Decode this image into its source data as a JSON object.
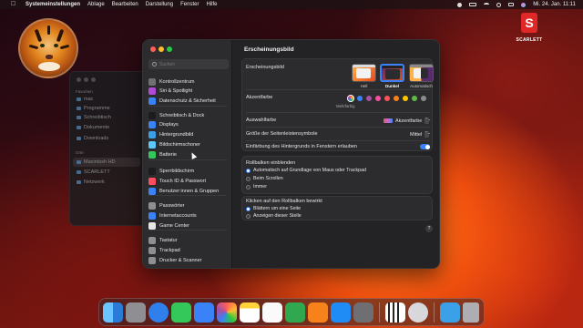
{
  "menubar": {
    "app_name": "Systemeinstellungen",
    "menus": [
      "Ablage",
      "Bearbeiten",
      "Darstellung",
      "Fenster",
      "Hilfe"
    ],
    "datetime": "Mi. 24. Jan. 11:11"
  },
  "logo": {
    "letter": "S",
    "text": "SCARLETT"
  },
  "finder": {
    "section_favorites": "Favoriten",
    "favorites": [
      "mac",
      "Programme",
      "Schreibtisch",
      "Dokumente",
      "Downloads"
    ],
    "section_places": "Orte",
    "places": [
      "Macintosh HD",
      "SCARLETT",
      "Netzwerk"
    ]
  },
  "settings": {
    "search_placeholder": "Suchen",
    "sidebar": [
      {
        "label": "Kontrollzentrum",
        "color": "#6e6e73"
      },
      {
        "label": "Siri & Spotlight",
        "color": "#b04ad6"
      },
      {
        "label": "Datenschutz & Sicherheit",
        "color": "#3a82f7"
      },
      {
        "label": "Schreibtisch & Dock",
        "color": "#1c1c1e"
      },
      {
        "label": "Displays",
        "color": "#3a82f7"
      },
      {
        "label": "Hintergrundbild",
        "color": "#3aa0e8"
      },
      {
        "label": "Bildschirmschoner",
        "color": "#5ac8fa"
      },
      {
        "label": "Batterie",
        "color": "#34c759"
      },
      {
        "label": "Sperrbildschirm",
        "color": "#1c1c1e"
      },
      {
        "label": "Touch ID & Passwort",
        "color": "#ff4d5e"
      },
      {
        "label": "Benutzer:innen & Gruppen",
        "color": "#3a82f7"
      },
      {
        "label": "Passwörter",
        "color": "#8e8e93"
      },
      {
        "label": "Internetaccounts",
        "color": "#3a82f7"
      },
      {
        "label": "Game Center",
        "color": "#e6e6e6"
      },
      {
        "label": "Tastatur",
        "color": "#8e8e93"
      },
      {
        "label": "Trackpad",
        "color": "#8e8e93"
      },
      {
        "label": "Drucker & Scanner",
        "color": "#8e8e93"
      }
    ],
    "title": "Erscheinungsbild",
    "appearance_label": "Erscheinungsbild",
    "appearance_options": [
      "Hell",
      "Dunkel",
      "Automatisch"
    ],
    "appearance_selected": "Dunkel",
    "accent_label": "Akzentfarbe",
    "accent_caption": "Mehrfarbig",
    "accent_colors": [
      "#3a82f7",
      "#a550a7",
      "#f74f9e",
      "#ff5257",
      "#f7821b",
      "#ffc600",
      "#62ba46",
      "#8c8c8c"
    ],
    "highlight_label": "Auswahlfarbe",
    "highlight_value": "Akzentfarbe",
    "sidebar_size_label": "Größe der Seitenleistensymbole",
    "sidebar_size_value": "Mittel",
    "tinting_label": "Einfärbung des Hintergrunds in Fenstern erlauben",
    "tinting_on": true,
    "scrollbars_label": "Rollbalken einblenden",
    "scrollbars_options": [
      "Automatisch auf Grundlage von Maus oder Trackpad",
      "Beim Scrollen",
      "Immer"
    ],
    "click_label": "Klicken auf den Rollbalken bewirkt",
    "click_options": [
      "Blättern um eine Seite",
      "Anzeigen dieser Stelle"
    ],
    "help": "?"
  },
  "dock": {
    "apps": [
      "Finder",
      "Launchpad",
      "Safari",
      "Nachrichten",
      "Mail",
      "Fotos",
      "Notizen",
      "Freeform",
      "Numbers",
      "Pages",
      "App Store",
      "Systemeinstellungen",
      "Klavier",
      "Programm",
      "Downloads",
      "Papierkorb"
    ]
  }
}
